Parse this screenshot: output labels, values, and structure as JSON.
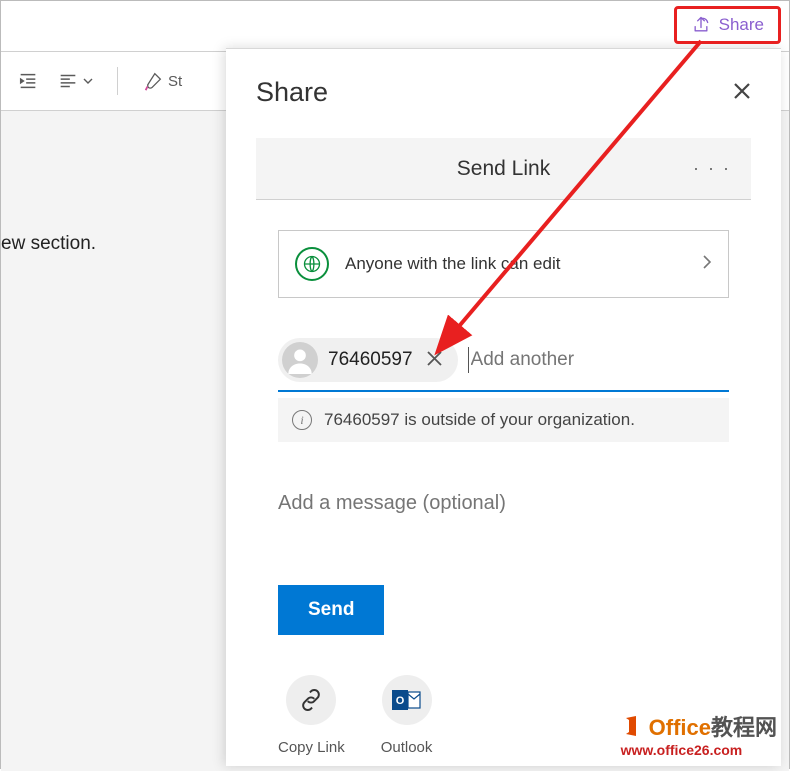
{
  "topShare": {
    "label": "Share"
  },
  "toolbar": {
    "styles": "St"
  },
  "doc": {
    "text": "ew section."
  },
  "panel": {
    "title": "Share",
    "sendLink": "Send Link",
    "scope": "Anyone with the link can edit",
    "chip": {
      "name": "76460597"
    },
    "addPlaceholder": "Add another",
    "warning": "76460597 is outside of your organization.",
    "messagePlaceholder": "Add a message (optional)",
    "sendBtn": "Send",
    "copyLink": "Copy Link",
    "outlook": "Outlook"
  },
  "watermark": {
    "brand1": "Office",
    "brand2": "教程网",
    "url": "www.office26.com"
  }
}
